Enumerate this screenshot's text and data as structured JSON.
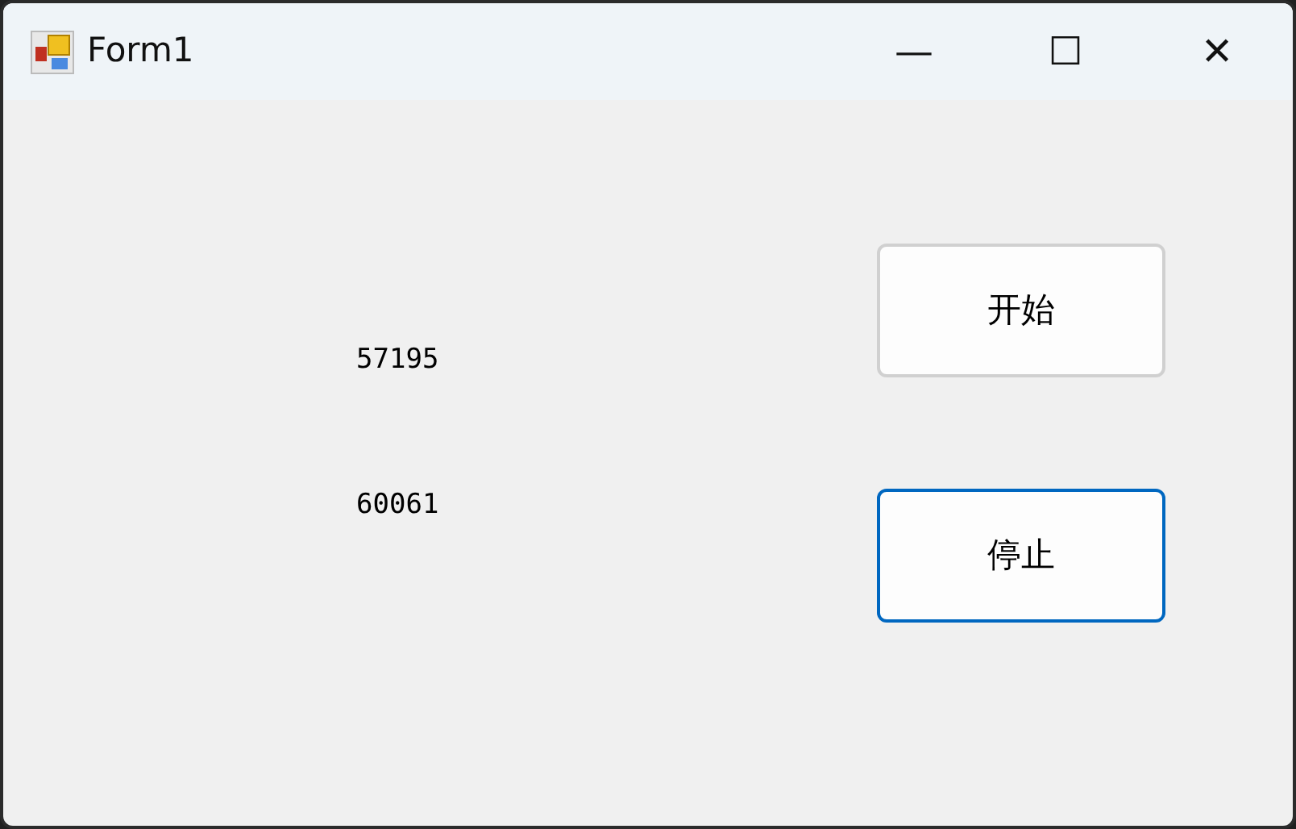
{
  "window": {
    "title": "Form1",
    "controls": [
      "—",
      "☐",
      "✕"
    ]
  },
  "labels": [
    "57195",
    "60061"
  ],
  "buttons": [
    {
      "label": "开始",
      "focused": false
    },
    {
      "label": "停止",
      "focused": true
    }
  ]
}
